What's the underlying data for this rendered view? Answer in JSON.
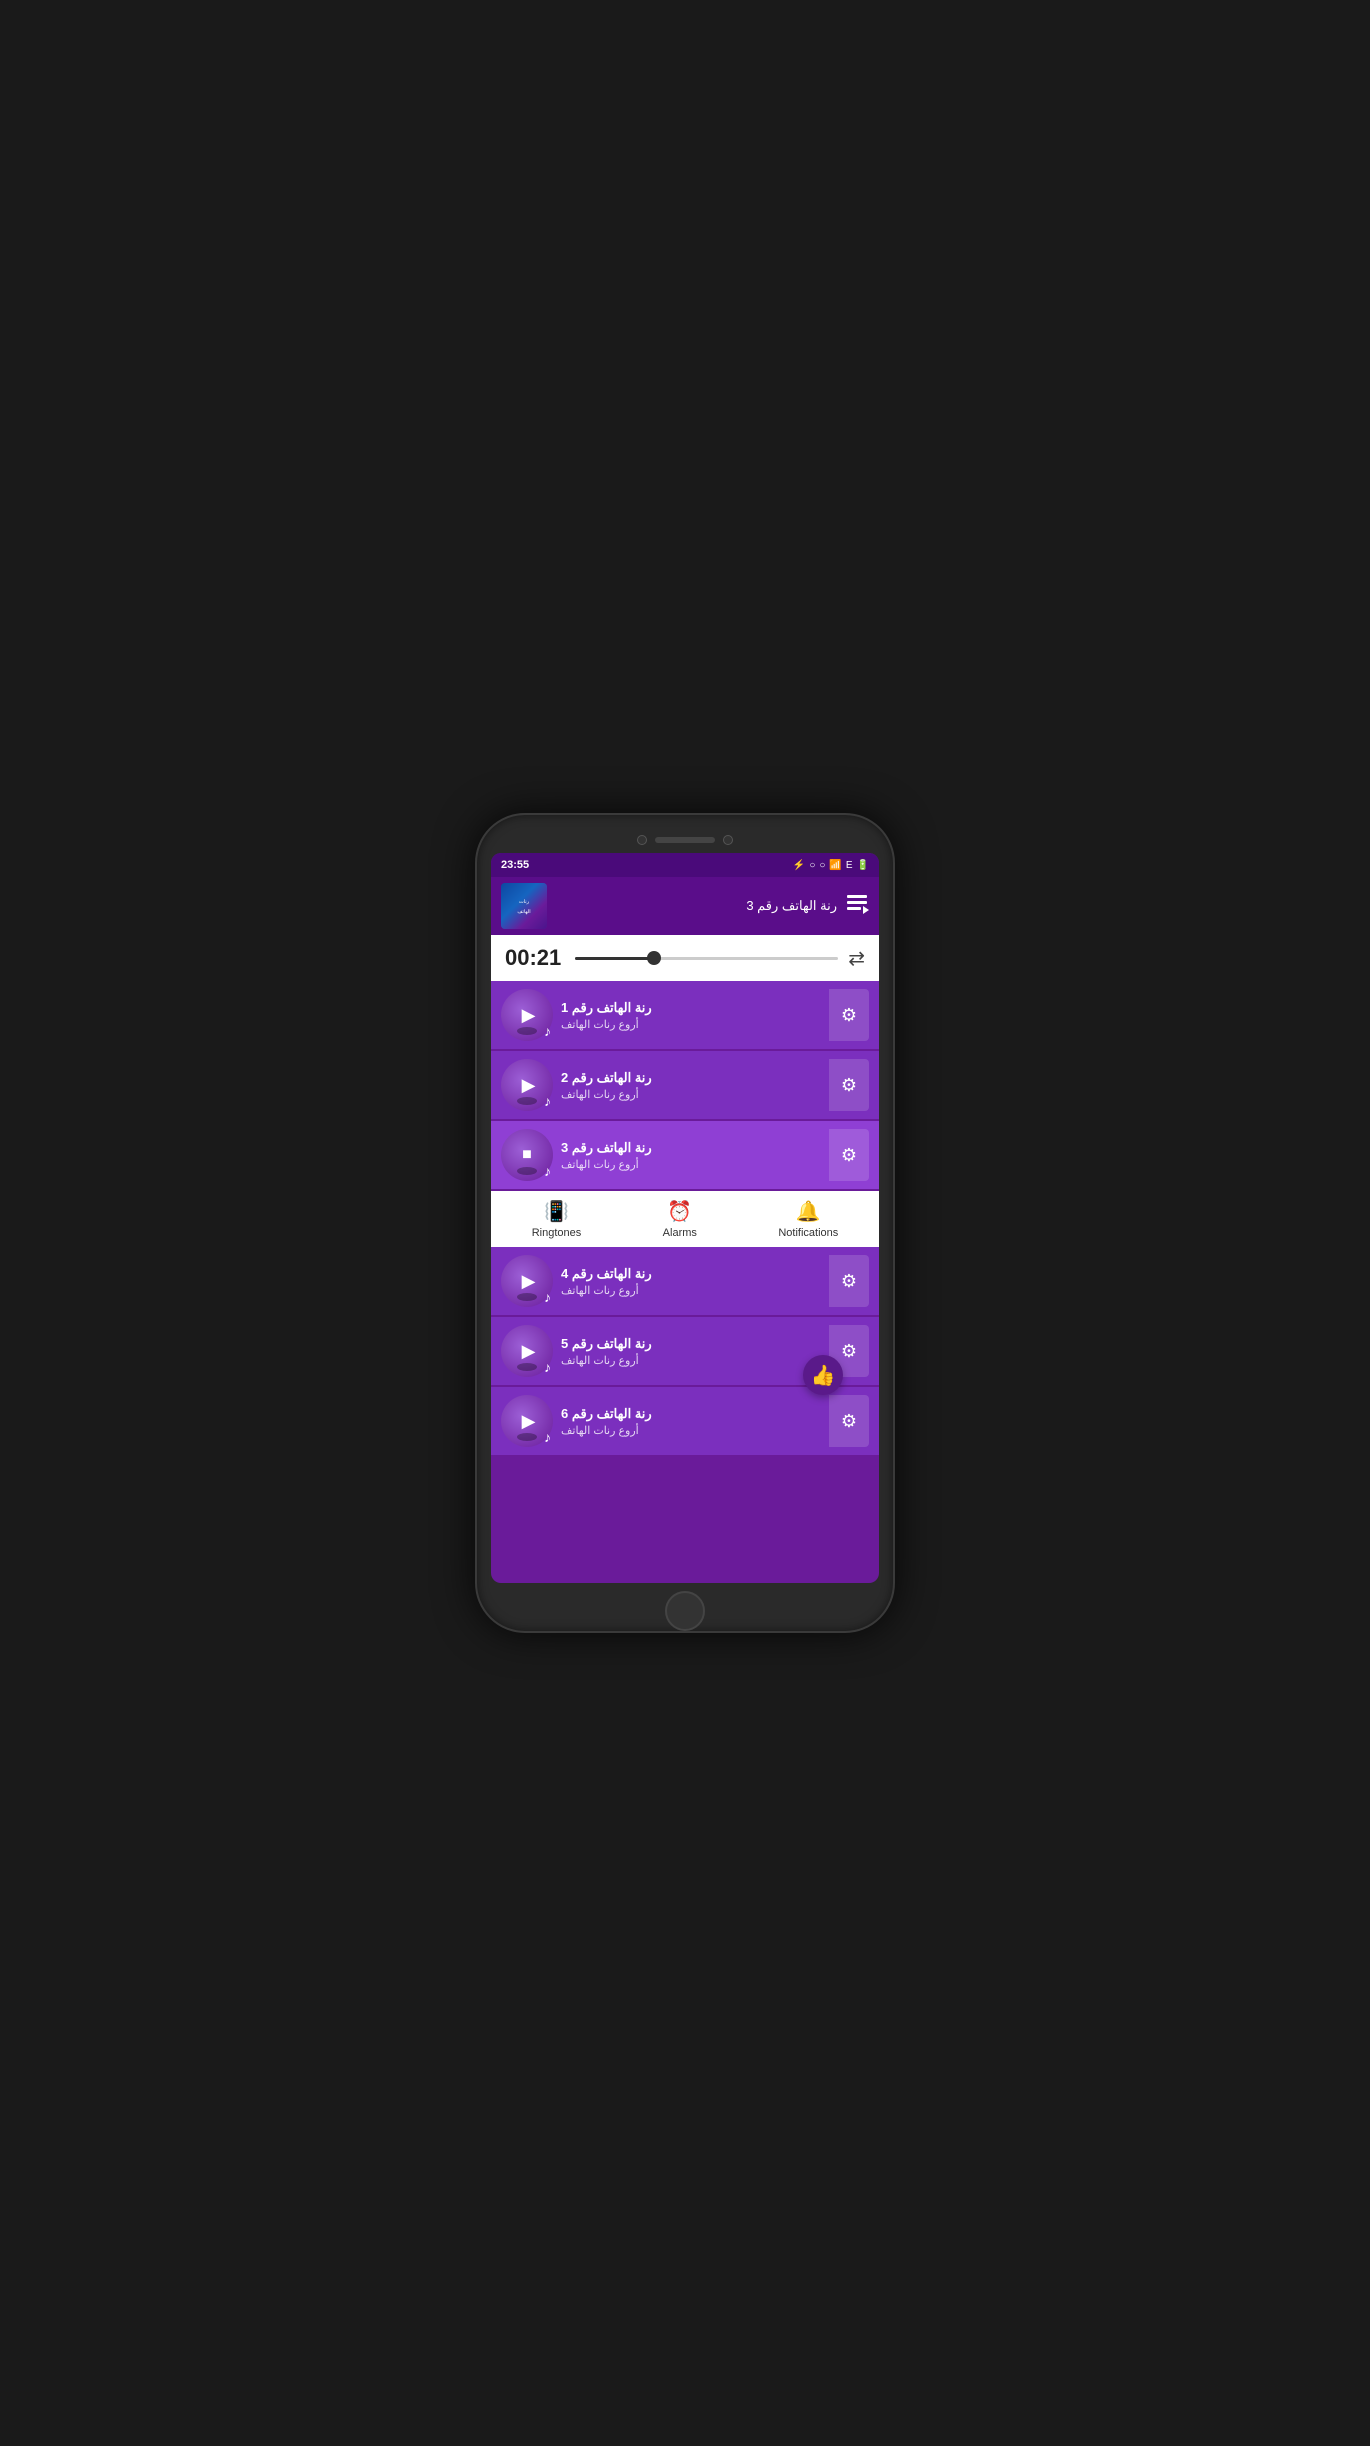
{
  "colors": {
    "primary": "#7b2fbe",
    "dark_purple": "#4a0a7a",
    "nav_bg": "#ffffff",
    "active_item": "#8f3fd4"
  },
  "status_bar": {
    "time": "23:55",
    "signal": "▐▌",
    "network": "E",
    "icons": [
      "⚡",
      "○",
      "○"
    ]
  },
  "now_playing": {
    "title": "رنة الهاتف رقم 3",
    "thumbnail_text": "رنات الهاتف"
  },
  "player": {
    "time": "00:21",
    "progress_percent": 30
  },
  "songs": [
    {
      "id": 1,
      "title": "رنة الهاتف رقم 1",
      "subtitle": "أروع رنات الهاتف",
      "playing": false,
      "active": false
    },
    {
      "id": 2,
      "title": "رنة الهاتف رقم 2",
      "subtitle": "أروع رنات الهاتف",
      "playing": false,
      "active": false
    },
    {
      "id": 3,
      "title": "رنة الهاتف رقم 3",
      "subtitle": "أروع رنات الهاتف",
      "playing": true,
      "active": true
    },
    {
      "id": 4,
      "title": "رنة الهاتف رقم 4",
      "subtitle": "أروع رنات الهاتف",
      "playing": false,
      "active": false
    },
    {
      "id": 5,
      "title": "رنة الهاتف رقم 5",
      "subtitle": "أروع رنات الهاتف",
      "playing": false,
      "active": false
    },
    {
      "id": 6,
      "title": "رنة الهاتف رقم 6",
      "subtitle": "أروع رنات الهاتف",
      "playing": false,
      "active": false
    }
  ],
  "bottom_nav": {
    "items": [
      {
        "id": "ringtones",
        "label": "Ringtones",
        "icon": "📳"
      },
      {
        "id": "alarms",
        "label": "Alarms",
        "icon": "⏰"
      },
      {
        "id": "notifications",
        "label": "Notifications",
        "icon": "🔔"
      }
    ]
  },
  "fab": {
    "icon": "👍"
  }
}
